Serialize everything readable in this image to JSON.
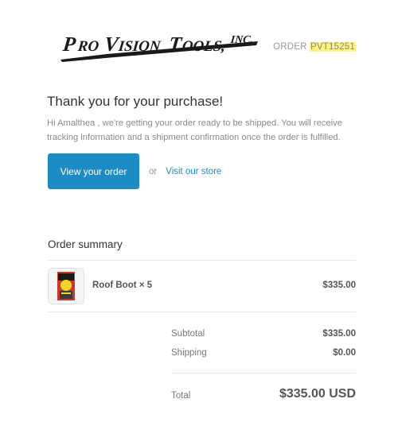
{
  "header": {
    "logo_text": "PROVISIONTOOLS, INC.",
    "order_prefix": "ORDER",
    "order_number": "PVT15251"
  },
  "message": {
    "title": "Thank you for your purchase!",
    "body": "Hi Amalthea , we're getting your order ready to be shipped. You will receive tracking information and a shipment confirmation once the order is fulfilled."
  },
  "actions": {
    "view_order_label": "View your order",
    "or_label": "or",
    "visit_store_label": "Visit our store"
  },
  "summary": {
    "title": "Order summary",
    "items": [
      {
        "name": "Roof Boot × 5",
        "price": "$335.00",
        "thumb_icon": "product-package-icon"
      }
    ],
    "subtotal_label": "Subtotal",
    "subtotal_value": "$335.00",
    "shipping_label": "Shipping",
    "shipping_value": "$0.00",
    "total_label": "Total",
    "total_value": "$335.00 USD"
  },
  "colors": {
    "accent": "#1d8cc5",
    "highlight": "#fff382",
    "logo": "#1a1a1a"
  }
}
